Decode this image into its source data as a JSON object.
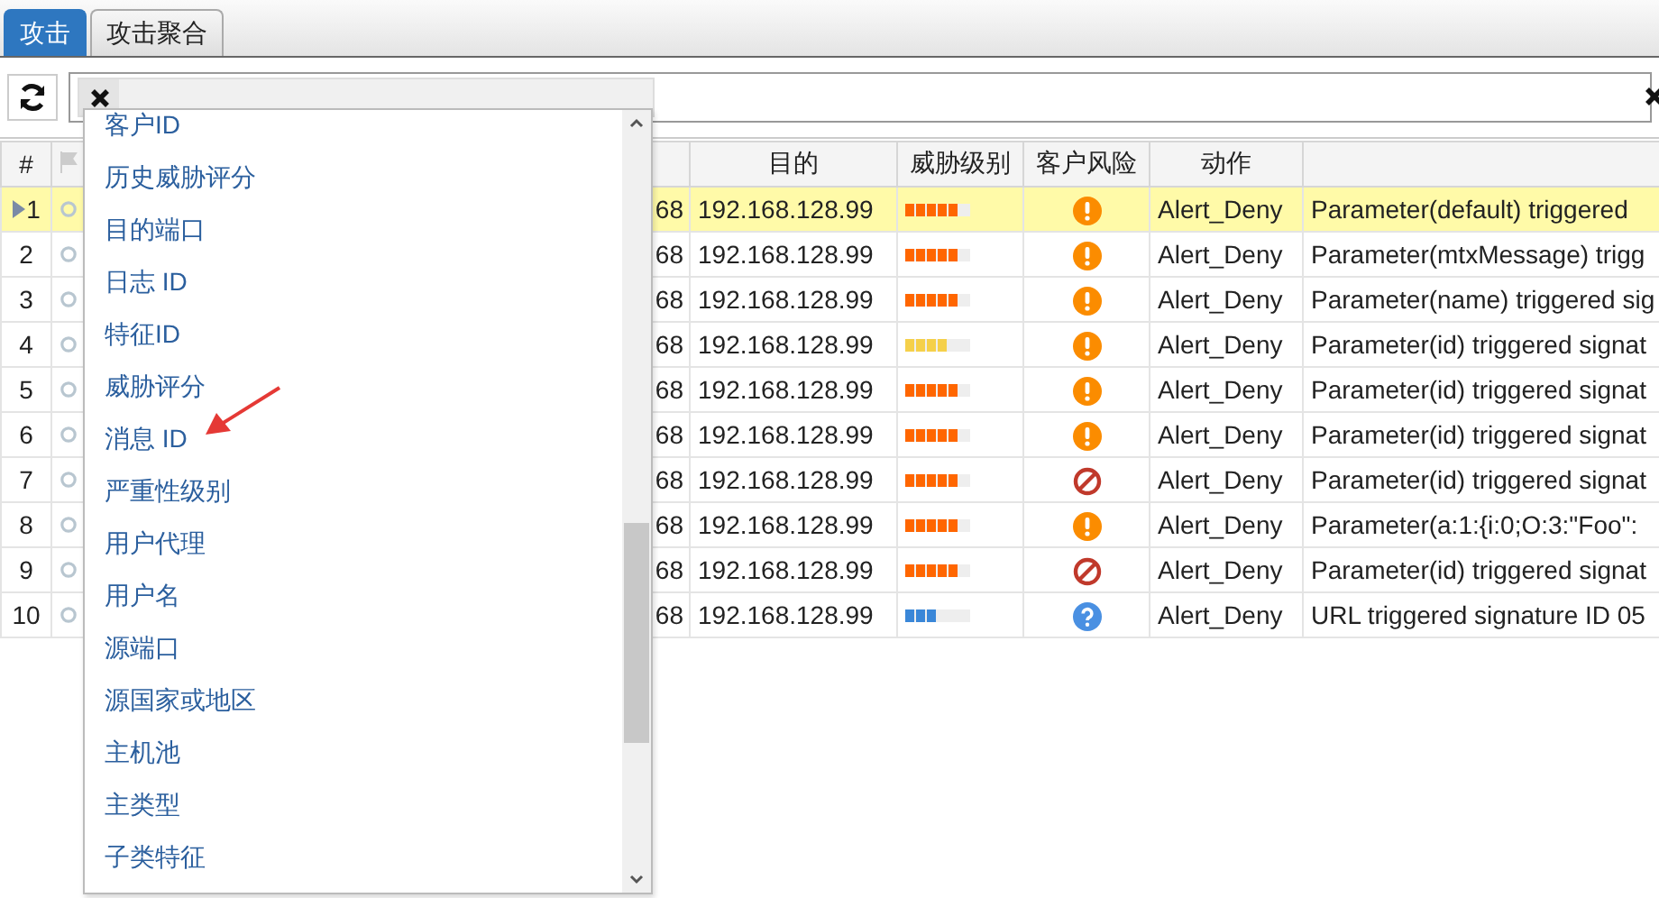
{
  "tabs": [
    {
      "label": "攻击",
      "selected": true
    },
    {
      "label": "攻击聚合",
      "selected": false
    }
  ],
  "table": {
    "columns": [
      "#",
      "",
      "目的",
      "威胁级别",
      "客户风险",
      "动作",
      ""
    ],
    "rows": [
      {
        "number": "1",
        "selected": true,
        "column_3": "68",
        "destination": "192.168.128.99",
        "threat": {
          "level": 0.83,
          "color": "#ff6600"
        },
        "risk": {
          "kind": "warning"
        },
        "action": "Alert_Deny",
        "message": "Parameter(default) triggered"
      },
      {
        "number": "2",
        "selected": false,
        "column_3": "68",
        "destination": "192.168.128.99",
        "threat": {
          "level": 0.83,
          "color": "#ff6600"
        },
        "risk": {
          "kind": "warning"
        },
        "action": "Alert_Deny",
        "message": "Parameter(mtxMessage) trigg"
      },
      {
        "number": "3",
        "selected": false,
        "column_3": "68",
        "destination": "192.168.128.99",
        "threat": {
          "level": 0.83,
          "color": "#ff6600"
        },
        "risk": {
          "kind": "warning"
        },
        "action": "Alert_Deny",
        "message": "Parameter(name) triggered sig"
      },
      {
        "number": "4",
        "selected": false,
        "column_3": "68",
        "destination": "192.168.128.99",
        "threat": {
          "level": 0.67,
          "color": "#f5d04a"
        },
        "risk": {
          "kind": "warning"
        },
        "action": "Alert_Deny",
        "message": "Parameter(id) triggered signat"
      },
      {
        "number": "5",
        "selected": false,
        "column_3": "68",
        "destination": "192.168.128.99",
        "threat": {
          "level": 0.83,
          "color": "#ff6600"
        },
        "risk": {
          "kind": "warning"
        },
        "action": "Alert_Deny",
        "message": "Parameter(id) triggered signat"
      },
      {
        "number": "6",
        "selected": false,
        "column_3": "68",
        "destination": "192.168.128.99",
        "threat": {
          "level": 0.83,
          "color": "#ff6600"
        },
        "risk": {
          "kind": "warning"
        },
        "action": "Alert_Deny",
        "message": "Parameter(id) triggered signat"
      },
      {
        "number": "7",
        "selected": false,
        "column_3": "68",
        "destination": "192.168.128.99",
        "threat": {
          "level": 0.83,
          "color": "#ff6600"
        },
        "risk": {
          "kind": "blocked"
        },
        "action": "Alert_Deny",
        "message": "Parameter(id) triggered signat"
      },
      {
        "number": "8",
        "selected": false,
        "column_3": "68",
        "destination": "192.168.128.99",
        "threat": {
          "level": 0.83,
          "color": "#ff6600"
        },
        "risk": {
          "kind": "warning"
        },
        "action": "Alert_Deny",
        "message": "Parameter(a:1:{i:0;O:3:\"Foo\":"
      },
      {
        "number": "9",
        "selected": false,
        "column_3": "68",
        "destination": "192.168.128.99",
        "threat": {
          "level": 0.83,
          "color": "#ff6600"
        },
        "risk": {
          "kind": "blocked"
        },
        "action": "Alert_Deny",
        "message": "Parameter(id) triggered signat"
      },
      {
        "number": "10",
        "selected": false,
        "column_3": "68",
        "destination": "192.168.128.99",
        "threat": {
          "level": 0.5,
          "color": "#3a87d8"
        },
        "risk": {
          "kind": "unknown"
        },
        "action": "Alert_Deny",
        "message": "URL triggered signature ID 05"
      }
    ]
  },
  "dropdown": {
    "items": [
      "客户ID",
      "历史威胁评分",
      "目的端口",
      "日志 ID",
      "特征ID",
      "威胁评分",
      "消息 ID",
      "严重性级别",
      "用户代理",
      "用户名",
      "源端口",
      "源国家或地区",
      "主机池",
      "主类型",
      "子类特征"
    ]
  }
}
